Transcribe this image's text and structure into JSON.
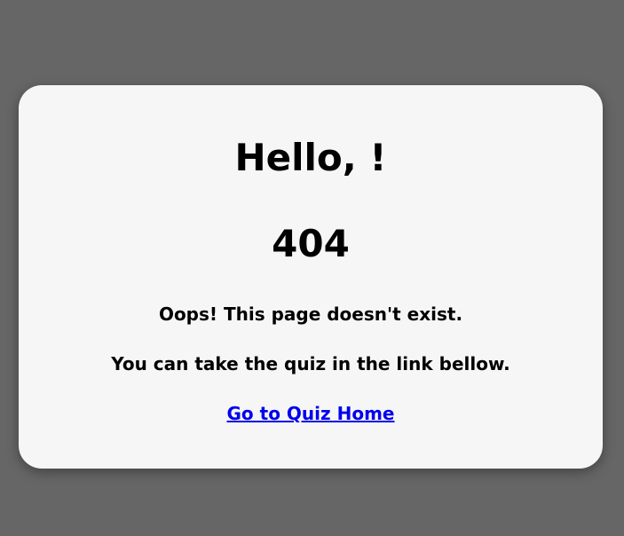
{
  "page": {
    "greeting": "Hello, !",
    "error_code": "404",
    "message": "Oops! This page doesn't exist.",
    "instruction": "You can take the quiz in the link bellow.",
    "link_label": "Go to Quiz Home"
  },
  "colors": {
    "background": "#666666",
    "card": "#f6f6f6",
    "link": "#0000ee"
  }
}
